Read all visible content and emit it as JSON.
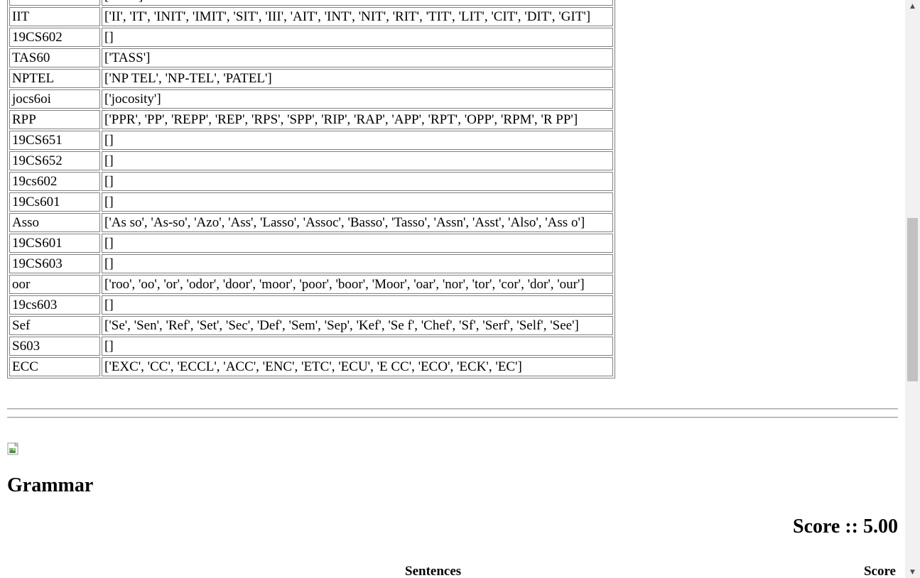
{
  "spell_table": {
    "partial_top": "['Suss']",
    "rows": [
      {
        "word": "IIT",
        "suggestions": "['II', 'IT', 'INIT', 'IMIT', 'SIT', 'III', 'AIT', 'INT', 'NIT', 'RIT', 'TIT', 'LIT', 'CIT', 'DIT', 'GIT']"
      },
      {
        "word": "19CS602",
        "suggestions": "[]"
      },
      {
        "word": "TAS60",
        "suggestions": "['TASS']"
      },
      {
        "word": "NPTEL",
        "suggestions": "['NP TEL', 'NP-TEL', 'PATEL']"
      },
      {
        "word": "jocs6oi",
        "suggestions": "['jocosity']"
      },
      {
        "word": "RPP",
        "suggestions": "['PPR', 'PP', 'REPP', 'REP', 'RPS', 'SPP', 'RIP', 'RAP', 'APP', 'RPT', 'OPP', 'RPM', 'R PP']"
      },
      {
        "word": "19CS651",
        "suggestions": "[]"
      },
      {
        "word": "19CS652",
        "suggestions": "[]"
      },
      {
        "word": "19cs602",
        "suggestions": "[]"
      },
      {
        "word": "19Cs601",
        "suggestions": "[]"
      },
      {
        "word": "Asso",
        "suggestions": "['As so', 'As-so', 'Azo', 'Ass', 'Lasso', 'Assoc', 'Basso', 'Tasso', 'Assn', 'Asst', 'Also', 'Ass o']"
      },
      {
        "word": "19CS601",
        "suggestions": "[]"
      },
      {
        "word": "19CS603",
        "suggestions": "[]"
      },
      {
        "word": "oor",
        "suggestions": "['roo', 'oo', 'or', 'odor', 'door', 'moor', 'poor', 'boor', 'Moor', 'oar', 'nor', 'tor', 'cor', 'dor', 'our']"
      },
      {
        "word": "19cs603",
        "suggestions": "[]"
      },
      {
        "word": "Sef",
        "suggestions": "['Se', 'Sen', 'Ref', 'Set', 'Sec', 'Def', 'Sem', 'Sep', 'Kef', 'Se f', 'Chef', 'Sf', 'Serf', 'Self', 'See']"
      },
      {
        "word": "S603",
        "suggestions": "[]"
      },
      {
        "word": "ECC",
        "suggestions": "['EXC', 'CC', 'ECCL', 'ACC', 'ENC', 'ETC', 'ECU', 'E CC', 'ECO', 'ECK', 'EC']"
      }
    ]
  },
  "grammar": {
    "title": "Grammar",
    "score_text": "Score :: 5.00",
    "columns": {
      "sentences": "Sentences",
      "score": "Score"
    }
  },
  "icons": {
    "broken_image": "broken-image-icon",
    "scroll_up": "chevron-up-icon",
    "scroll_down": "chevron-down-icon"
  }
}
